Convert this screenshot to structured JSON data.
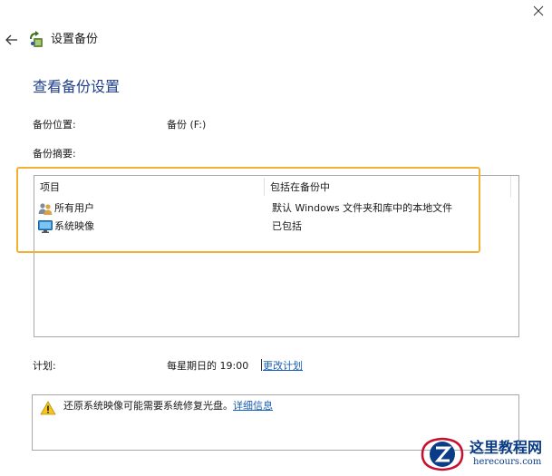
{
  "window": {
    "title": "设置备份"
  },
  "page": {
    "title": "查看备份设置"
  },
  "backup_location": {
    "label": "备份位置:",
    "value": "备份 (F:)"
  },
  "summary": {
    "label": "备份摘要:",
    "columns": [
      "项目",
      "包括在备份中"
    ],
    "rows": [
      {
        "icon": "users-icon",
        "name": "所有用户",
        "included": "默认 Windows 文件夹和库中的本地文件"
      },
      {
        "icon": "monitor-icon",
        "name": "系统映像",
        "included": "已包括"
      }
    ]
  },
  "schedule": {
    "label": "计划:",
    "value": "每星期日的 19:00",
    "change_link": "更改计划"
  },
  "warning": {
    "text": "还原系统映像可能需要系统修复光盘。",
    "link": "详细信息"
  },
  "watermark": {
    "title": "这里教程网",
    "url": "herecours.com"
  },
  "colors": {
    "title_blue": "#1f3f8a",
    "link_blue": "#1a5fb4",
    "highlight": "#f2b134"
  }
}
